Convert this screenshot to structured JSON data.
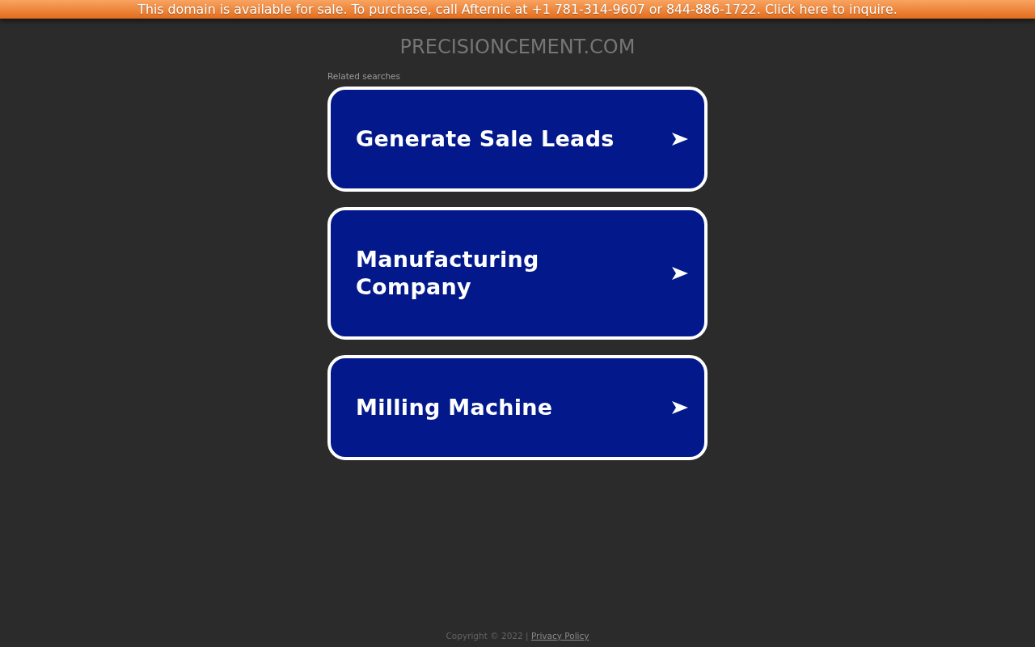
{
  "banner": {
    "text": "This domain is available for sale. To purchase, call Afternic at +1 781-314-9607 or 844-886-1722. Click here to inquire."
  },
  "domain": "PRECISIONCEMENT.COM",
  "related": {
    "heading": "Related searches",
    "links": [
      "Generate Sale Leads",
      "Manufacturing Company",
      "Milling Machine"
    ]
  },
  "footer": {
    "copyright": "Copyright © 2022 |",
    "privacy_link": "Privacy Policy"
  }
}
